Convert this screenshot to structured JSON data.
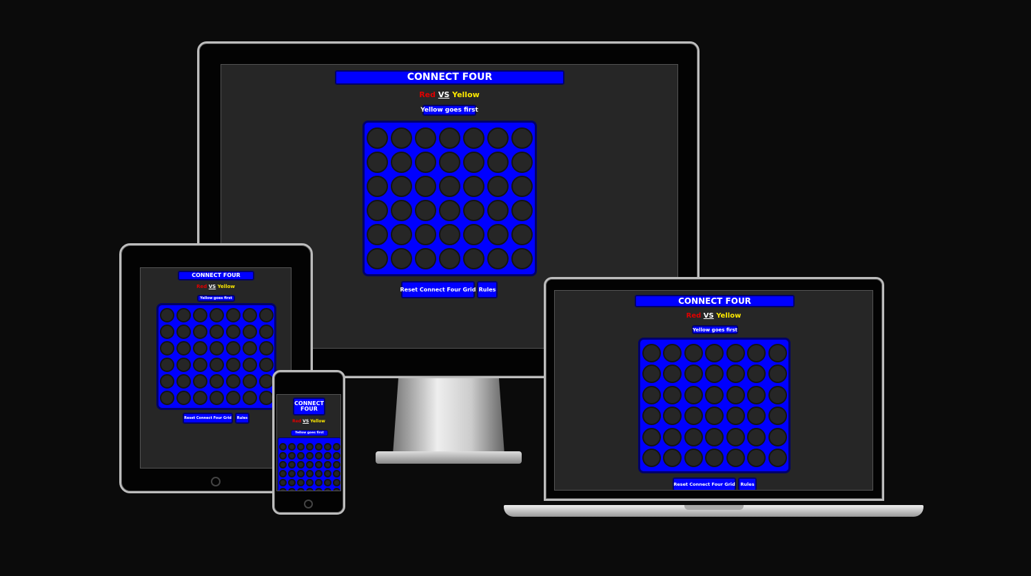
{
  "game": {
    "title": "CONNECT FOUR",
    "red": "Red",
    "vs": "VS",
    "yellow": "Yellow",
    "turn": "Yellow goes first",
    "reset": "Reset Connect Four Grid",
    "rules": "Rules",
    "rows": 6,
    "cols": 7
  },
  "colors": {
    "board": "#0000ff",
    "red": "#e00000",
    "yellow": "#ffea00",
    "background": "#262626"
  }
}
